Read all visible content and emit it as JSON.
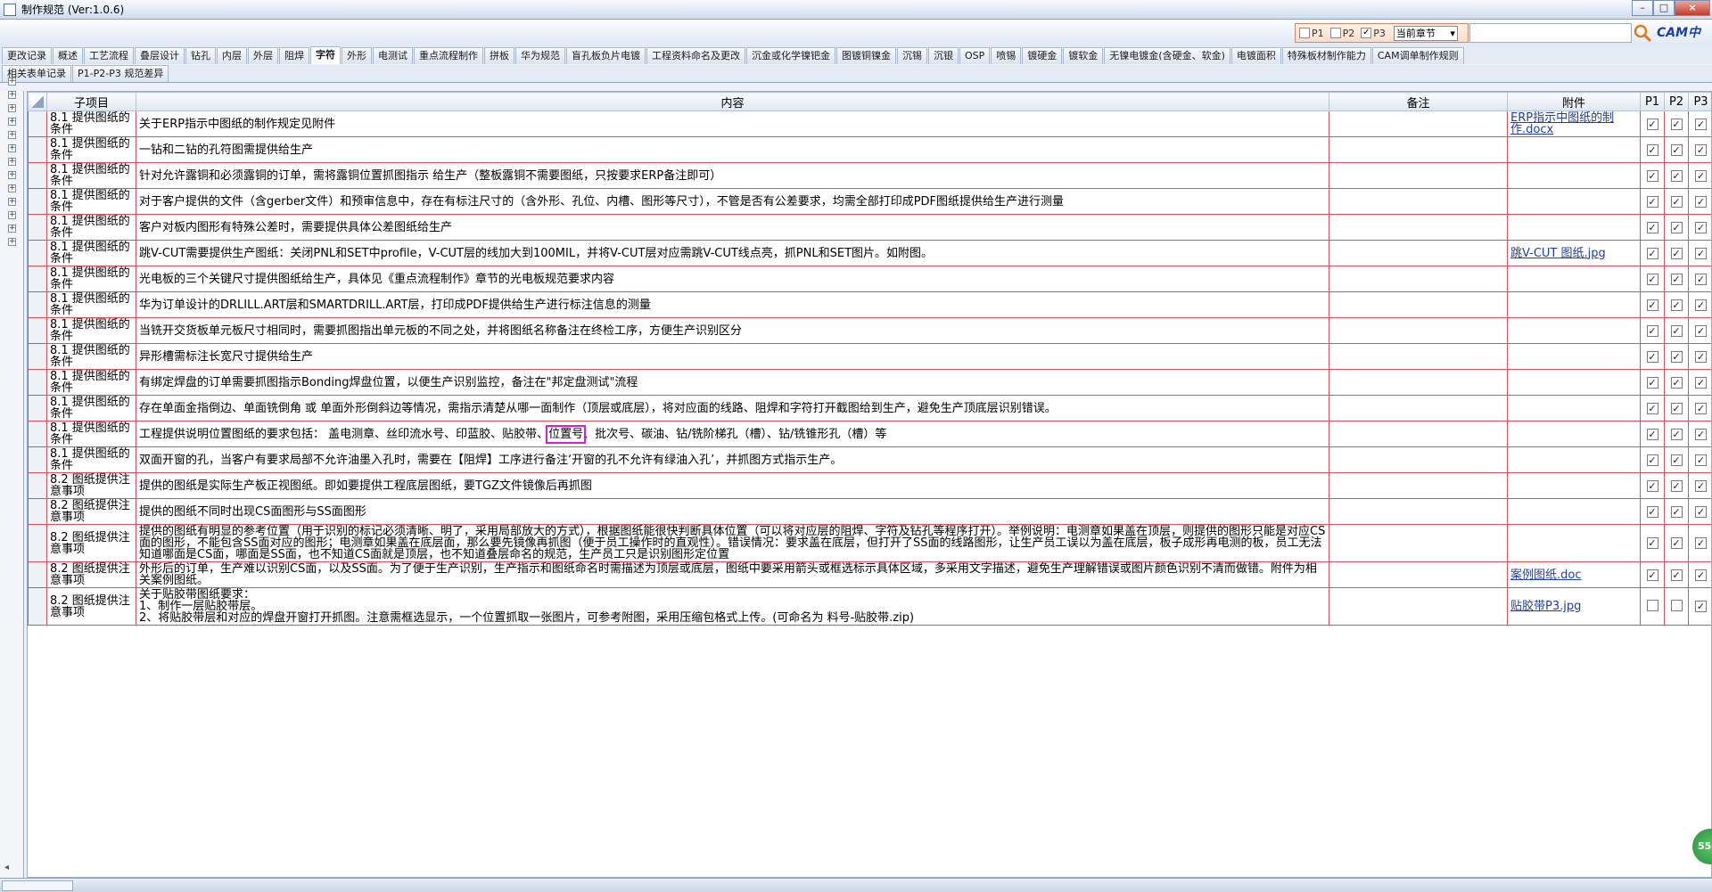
{
  "window": {
    "title": "制作规范 (Ver:1.0.6)",
    "min": "–",
    "max": "□",
    "close": "×"
  },
  "filter": {
    "p1": "P1",
    "p2": "P2",
    "p3": "P3",
    "p1_checked": false,
    "p2_checked": false,
    "p3_checked": true,
    "chapter_value": "当前章节"
  },
  "search": {
    "value": ""
  },
  "brand": "CAM中心",
  "tabs_row1": [
    "更改记录",
    "概述",
    "工艺流程",
    "叠层设计",
    "钻孔",
    "内层",
    "外层",
    "阻焊",
    "字符",
    "外形",
    "电测试",
    "重点流程制作",
    "拼板",
    "华为规范",
    "盲孔板负片电镀",
    "工程资料命名及更改",
    "沉金或化学镍钯金",
    "图镀铜镍金",
    "沉锡",
    "沉银",
    "OSP",
    "喷锡",
    "镀硬金",
    "镀软金",
    "无镍电镀金(含硬金、软金)",
    "电镀面积",
    "特殊板材制作能力",
    "CAM调单制作规则"
  ],
  "active_tab": "字符",
  "tabs_row2": [
    "相关表单记录",
    "P1-P2-P3 规范差异"
  ],
  "columns": {
    "sub": "子项目",
    "content": "内容",
    "remark": "备注",
    "attachment": "附件",
    "p1": "P1",
    "p2": "P2",
    "p3": "P3"
  },
  "rows": [
    {
      "sub": "8.1 提供图纸的条件",
      "content": "关于ERP指示中图纸的制作规定见附件",
      "remark": "",
      "attachment": "ERP指示中图纸的制作.docx",
      "p1": true,
      "p2": true,
      "p3": true
    },
    {
      "sub": "8.1 提供图纸的条件",
      "content": "一钻和二钻的孔符图需提供给生产",
      "remark": "",
      "attachment": "",
      "p1": true,
      "p2": true,
      "p3": true
    },
    {
      "sub": "8.1 提供图纸的条件",
      "content": "针对允许露铜和必须露铜的订单，需将露铜位置抓图指示 给生产（整板露铜不需要图纸，只按要求ERP备注即可）",
      "remark": "",
      "attachment": "",
      "p1": true,
      "p2": true,
      "p3": true
    },
    {
      "sub": "8.1 提供图纸的条件",
      "content": "对于客户提供的文件（含gerber文件）和预审信息中，存在有标注尺寸的（含外形、孔位、内槽、图形等尺寸），不管是否有公差要求，均需全部打印成PDF图纸提供给生产进行测量",
      "remark": "",
      "attachment": "",
      "p1": true,
      "p2": true,
      "p3": true
    },
    {
      "sub": "8.1 提供图纸的条件",
      "content": "客户对板内图形有特殊公差时，需要提供具体公差图纸给生产",
      "remark": "",
      "attachment": "",
      "p1": true,
      "p2": true,
      "p3": true
    },
    {
      "sub": "8.1 提供图纸的条件",
      "content": "跳V-CUT需要提供生产图纸：关闭PNL和SET中profile，V-CUT层的线加大到100MIL，并将V-CUT层对应需跳V-CUT线点亮，抓PNL和SET图片。如附图。",
      "remark": "",
      "attachment": "跳V-CUT 图纸.jpg",
      "p1": true,
      "p2": true,
      "p3": true
    },
    {
      "sub": "8.1 提供图纸的条件",
      "content": "光电板的三个关键尺寸提供图纸给生产，具体见《重点流程制作》章节的光电板规范要求内容",
      "remark": "",
      "attachment": "",
      "p1": true,
      "p2": true,
      "p3": true
    },
    {
      "sub": "8.1 提供图纸的条件",
      "content": "华为订单设计的DRLILL.ART层和SMARTDRILL.ART层，打印成PDF提供给生产进行标注信息的测量",
      "remark": "",
      "attachment": "",
      "p1": true,
      "p2": true,
      "p3": true
    },
    {
      "sub": "8.1 提供图纸的条件",
      "content": "当铣开交货板单元板尺寸相同时，需要抓图指出单元板的不同之处，并将图纸名称备注在终检工序，方便生产识别区分",
      "remark": "",
      "attachment": "",
      "p1": true,
      "p2": true,
      "p3": true
    },
    {
      "sub": "8.1 提供图纸的条件",
      "content": "异形槽需标注长宽尺寸提供给生产",
      "remark": "",
      "attachment": "",
      "p1": true,
      "p2": true,
      "p3": true
    },
    {
      "sub": "8.1 提供图纸的条件",
      "content": "有绑定焊盘的订单需要抓图指示Bonding焊盘位置，以便生产识别监控，备注在\"邦定盘测试\"流程",
      "remark": "",
      "attachment": "",
      "p1": true,
      "p2": true,
      "p3": true
    },
    {
      "sub": "8.1 提供图纸的条件",
      "content": "存在单面金指倒边、单面铣倒角 或 单面外形倒斜边等情况，需指示清楚从哪一面制作（顶层或底层），将对应面的线路、阻焊和字符打开截图给到生产，避免生产顶底层识别错误。",
      "remark": "",
      "attachment": "",
      "p1": true,
      "p2": true,
      "p3": true
    },
    {
      "sub": "8.1 提供图纸的条件",
      "content_pre": "工程提供说明位置图纸的要求包括：  盖电测章、丝印流水号、印蓝胶、贴胶带、",
      "content_hl": "位置号",
      "content_post": "、批次号、碳油、钻/铣阶梯孔（槽）、钻/铣锥形孔（槽）等",
      "remark": "",
      "attachment": "",
      "p1": true,
      "p2": true,
      "p3": true
    },
    {
      "sub": "8.1 提供图纸的条件",
      "content": "双面开窗的孔，当客户有要求局部不允许油墨入孔时，需要在【阻焊】工序进行备注‘开窗的孔不允许有绿油入孔’，并抓图方式指示生产。",
      "remark": "",
      "attachment": "",
      "p1": true,
      "p2": true,
      "p3": true
    },
    {
      "sub": "8.2 图纸提供注意事项",
      "content": "提供的图纸是实际生产板正视图纸。即如要提供工程底层图纸，要TGZ文件镜像后再抓图",
      "remark": "",
      "attachment": "",
      "p1": true,
      "p2": true,
      "p3": true
    },
    {
      "sub": "8.2 图纸提供注意事项",
      "content": "提供的图纸不同时出现CS面图形与SS面图形",
      "remark": "",
      "attachment": "",
      "p1": true,
      "p2": true,
      "p3": true
    },
    {
      "sub": "8.2 图纸提供注意事项",
      "content": "提供的图纸有明显的参考位置（用于识别的标记必须清晰、明了，采用局部放大的方式），根据图纸能很快判断具体位置（可以将对应层的阻焊、字符及钻孔等程序打开）。举例说明：电测章如果盖在顶层，则提供的图形只能是对应CS面的图形，不能包含SS面对应的图形；电测章如果盖在底层面，那么要先镜像再抓图（便于员工操作时的直观性）。错误情况：要求盖在底层，但打开了SS面的线路图形，让生产员工误以为盖在底层，板子成形再电测的板，员工无法知道哪面是CS面，哪面是SS面，也不知道CS面就是顶层，也不知道叠层命名的规范，生产员工只是识别图形定位置",
      "remark": "",
      "attachment": "",
      "p1": true,
      "p2": true,
      "p3": true
    },
    {
      "sub": "8.2 图纸提供注意事项",
      "content": "外形后的订单，生产难以识别CS面，以及SS面。为了便于生产识别，生产指示和图纸命名时需描述为顶层或底层，图纸中要采用箭头或框选标示具体区域，多采用文字描述，避免生产理解错误或图片颜色识别不清而做错。附件为相关案例图纸。",
      "remark": "",
      "attachment": "案例图纸.doc",
      "p1": true,
      "p2": true,
      "p3": true
    },
    {
      "sub": "8.2 图纸提供注意事项",
      "content_lines": [
        "关于贴胶带图纸要求：",
        "1、制作一层贴胶带层。",
        "2、将贴胶带层和对应的焊盘开窗打开抓图。注意需框选显示，一个位置抓取一张图片，可参考附图，采用压缩包格式上传。(可命名为 料号-贴胶带.zip)"
      ],
      "remark": "",
      "attachment": "贴胶带P3.jpg",
      "p1": false,
      "p2": false,
      "p3": true
    }
  ],
  "status": {
    "bubble": "55"
  }
}
